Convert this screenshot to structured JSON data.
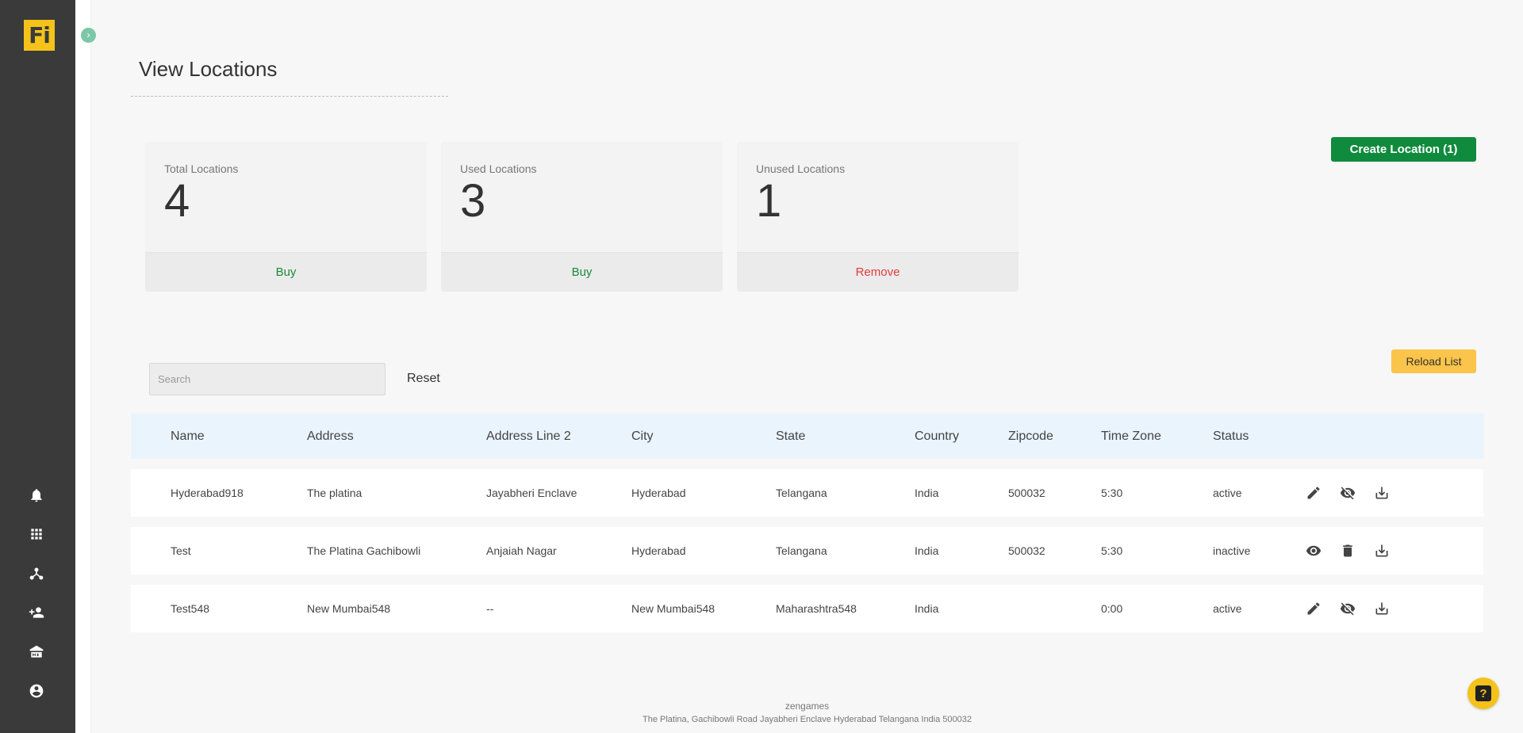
{
  "app": {
    "logo_text": "Fi"
  },
  "page": {
    "title": "View Locations"
  },
  "cards": [
    {
      "label": "Total Locations",
      "value": "4",
      "action": "Buy"
    },
    {
      "label": "Used Locations",
      "value": "3",
      "action": "Buy"
    },
    {
      "label": "Unused Locations",
      "value": "1",
      "action": "Remove"
    }
  ],
  "toolbar": {
    "create_label": "Create Location (1)",
    "reload_label": "Reload List",
    "search_placeholder": "Search",
    "reset_label": "Reset"
  },
  "table": {
    "headers": [
      "Name",
      "Address",
      "Address Line 2",
      "City",
      "State",
      "Country",
      "Zipcode",
      "Time Zone",
      "Status"
    ],
    "rows": [
      {
        "cells": [
          "Hyderabad918",
          "The platina",
          "Jayabheri Enclave",
          "Hyderabad",
          "Telangana",
          "India",
          "500032",
          "5:30",
          "active"
        ],
        "actions": [
          "edit-icon",
          "visibility-off-icon",
          "download-icon"
        ]
      },
      {
        "cells": [
          "Test",
          "The Platina Gachibowli",
          "Anjaiah Nagar",
          "Hyderabad",
          "Telangana",
          "India",
          "500032",
          "5:30",
          "inactive"
        ],
        "actions": [
          "visibility-icon",
          "delete-icon",
          "download-icon"
        ]
      },
      {
        "cells": [
          "Test548",
          "New Mumbai548",
          "--",
          "New Mumbai548",
          "Maharashtra548",
          "India",
          "",
          "0:00",
          "active"
        ],
        "actions": [
          "edit-icon",
          "visibility-off-icon",
          "download-icon"
        ]
      }
    ]
  },
  "footer": {
    "company": "zengames",
    "address": "The Platina, Gachibowli Road Jayabheri Enclave Hyderabad Telangana India 500032"
  },
  "sidebar": {
    "icons": [
      "bell-icon",
      "apps-grid-icon",
      "hub-icon",
      "add-user-icon",
      "bank-icon",
      "account-icon"
    ]
  },
  "colors": {
    "primary_green": "#108a3d",
    "accent_yellow": "#f4c21a",
    "sidebar": "#3a3a3a",
    "danger": "#e23b3b",
    "header_blue": "#eaf4fd"
  }
}
